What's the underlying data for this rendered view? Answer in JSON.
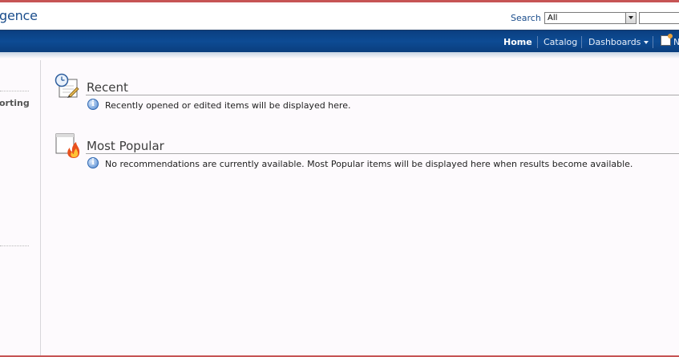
{
  "header": {
    "app_title": "gence",
    "search_label": "Search",
    "search_scope": "All",
    "search_value": ""
  },
  "nav": {
    "home": "Home",
    "catalog": "Catalog",
    "dashboards": "Dashboards",
    "new_label": "N"
  },
  "left_pane": {
    "item_text": "orting"
  },
  "sections": {
    "recent": {
      "title": "Recent",
      "message": "Recently opened or edited items will be displayed here."
    },
    "most_popular": {
      "title": "Most Popular",
      "message": "No recommendations are currently available. Most Popular items will be displayed here when results become available."
    }
  },
  "icons": {
    "recent": "clock-document-icon",
    "most_popular": "flame-document-icon",
    "info": "info-icon",
    "new": "new-item-icon"
  },
  "colors": {
    "nav_background": "#0d4b94",
    "title_blue": "#1a4d8c",
    "frame_border": "#c65454",
    "page_background": "#fdfafd"
  }
}
